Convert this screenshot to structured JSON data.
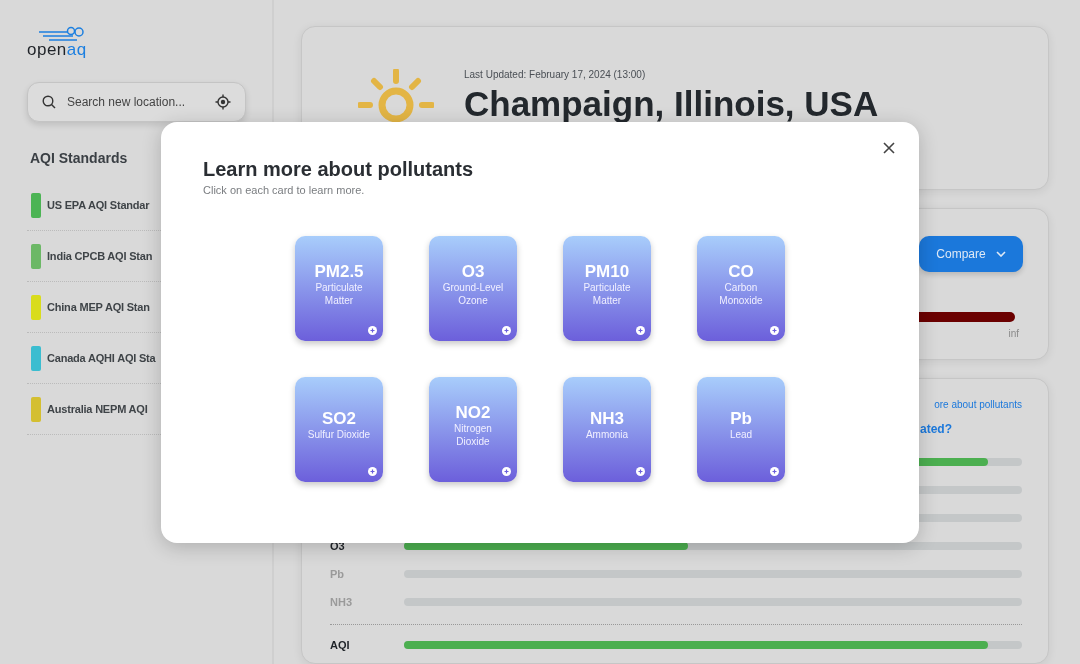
{
  "sidebar": {
    "logo": {
      "text_dark": "open",
      "text_accent": "aq"
    },
    "search": {
      "placeholder": "Search new location..."
    },
    "standards_title": "AQI Standards",
    "standards": [
      {
        "label": "US EPA AQI Standar",
        "color": "#4cb454"
      },
      {
        "label": "India CPCB AQI Stan",
        "color": "#6cb866"
      },
      {
        "label": "China MEP AQI Stan",
        "color": "#d9dc1c"
      },
      {
        "label": "Canada AQHI AQI Sta",
        "color": "#3bbdd0"
      },
      {
        "label": "Australia NEPM AQI",
        "color": "#d4bf31"
      }
    ]
  },
  "location_card": {
    "last_updated": "Last Updated: February 17, 2024 (13:00)",
    "title": "Champaign, Illinois, USA"
  },
  "scale_card": {
    "compare_button": "Compare",
    "scale_end": "inf"
  },
  "pollutants_card": {
    "link": "ore about pollutants",
    "heading": "ated?",
    "rows": [
      {
        "level": 0.945
      },
      {},
      {},
      {
        "label": "O3",
        "level": 0.46,
        "highlighted": true
      },
      {
        "label": "Pb",
        "highlighted": false
      },
      {
        "label": "NH3",
        "highlighted": false
      }
    ],
    "total": {
      "label": "AQI",
      "level": 0.945
    }
  },
  "modal": {
    "title": "Learn more about pollutants",
    "subtitle": "Click on each card to learn more.",
    "cards": [
      {
        "symbol": "PM2.5",
        "name": "Particulate Matter"
      },
      {
        "symbol": "O3",
        "name": "Ground-Level Ozone"
      },
      {
        "symbol": "PM10",
        "name": "Particulate Matter"
      },
      {
        "symbol": "CO",
        "name": "Carbon Monoxide"
      },
      {
        "symbol": "SO2",
        "name": "Sulfur Dioxide"
      },
      {
        "symbol": "NO2",
        "name": "Nitrogen Dioxide"
      },
      {
        "symbol": "NH3",
        "name": "Ammonia"
      },
      {
        "symbol": "Pb",
        "name": "Lead"
      }
    ]
  }
}
